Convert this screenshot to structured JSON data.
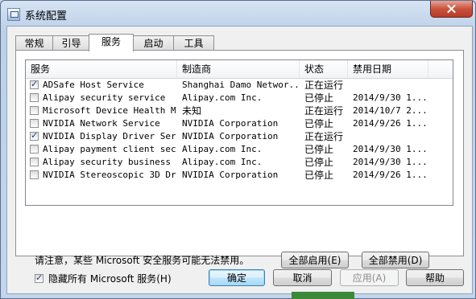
{
  "window": {
    "title": "系统配置"
  },
  "tabs": [
    "常规",
    "引导",
    "服务",
    "启动",
    "工具"
  ],
  "active_tab": "服务",
  "columns": [
    "服务",
    "制造商",
    "状态",
    "禁用日期"
  ],
  "services": [
    {
      "checked": true,
      "name": "ADSafe Host Service",
      "maker": "Shanghai Damo Networ...",
      "status": "正在运行",
      "date": ""
    },
    {
      "checked": false,
      "name": "Alipay security service",
      "maker": "Alipay.com Inc.",
      "status": "已停止",
      "date": "2014/9/30 1..."
    },
    {
      "checked": false,
      "name": "Microsoft Device Health M...",
      "maker": "未知",
      "status": "正在运行",
      "date": "2014/10/7 2..."
    },
    {
      "checked": false,
      "name": "NVIDIA Network Service",
      "maker": "NVIDIA Corporation",
      "status": "已停止",
      "date": "2014/9/26 1..."
    },
    {
      "checked": true,
      "name": "NVIDIA Display Driver Ser...",
      "maker": "NVIDIA Corporation",
      "status": "正在运行",
      "date": ""
    },
    {
      "checked": false,
      "name": "Alipay payment client sec...",
      "maker": "Alipay.com Inc.",
      "status": "已停止",
      "date": "2014/9/30 1..."
    },
    {
      "checked": false,
      "name": "Alipay security business ...",
      "maker": "Alipay.com Inc.",
      "status": "已停止",
      "date": "2014/9/30 1..."
    },
    {
      "checked": false,
      "name": "NVIDIA Stereoscopic 3D Dr...",
      "maker": "NVIDIA Corporation",
      "status": "已停止",
      "date": "2014/9/26 1..."
    }
  ],
  "note": "请注意，某些 Microsoft 安全服务可能无法禁用。",
  "enable_all": "全部启用(E)",
  "disable_all": "全部禁用(D)",
  "hide_ms_label": "隐藏所有 Microsoft 服务(H)",
  "hide_ms_checked": true,
  "buttons": {
    "ok": "确定",
    "cancel": "取消",
    "apply": "应用(A)",
    "help": "帮助"
  }
}
